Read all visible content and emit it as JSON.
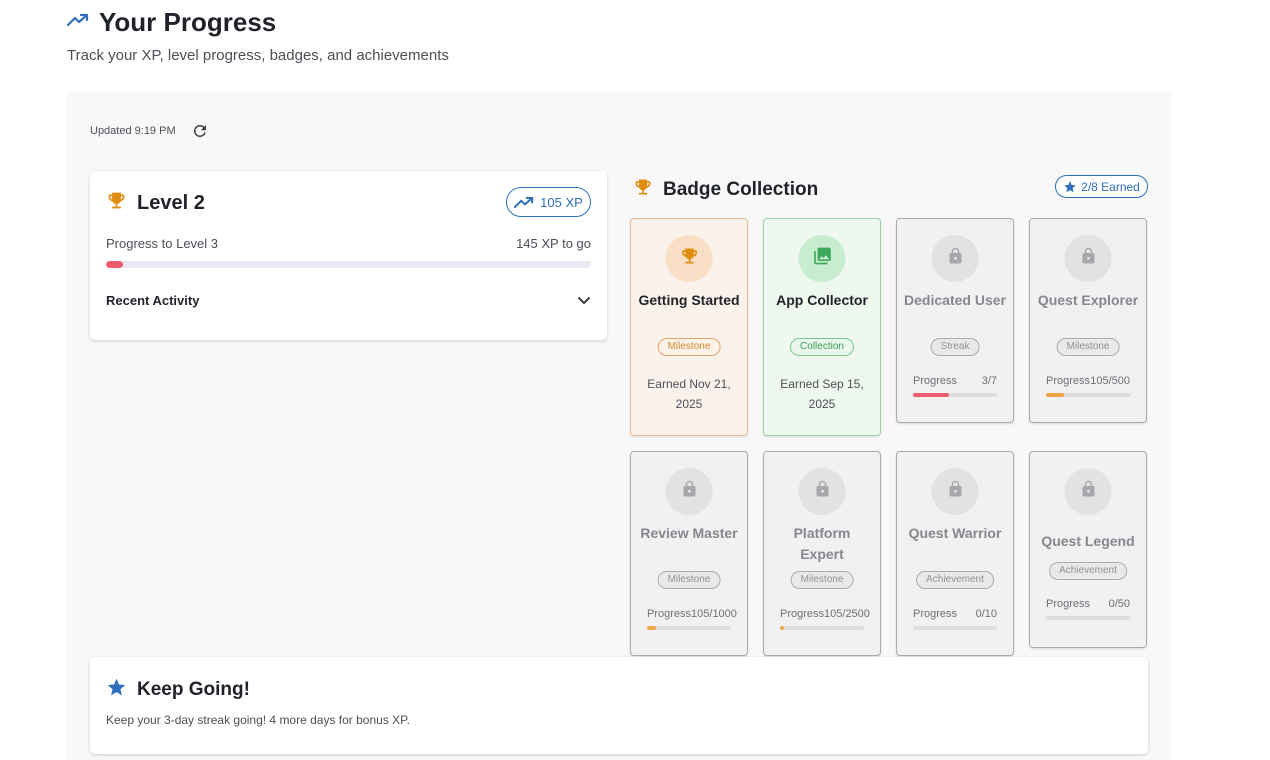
{
  "header": {
    "title": "Your Progress",
    "subtitle": "Track your XP, level progress, badges, and achievements"
  },
  "toolbar": {
    "updated_text": "Updated 9:19 PM"
  },
  "level": {
    "title": "Level 2",
    "xp_chip": "105 XP",
    "progress_label": "Progress to Level 3",
    "xp_to_go": "145 XP to go",
    "progress_fraction": 0.035,
    "recent_activity_label": "Recent Activity"
  },
  "badges": {
    "title": "Badge Collection",
    "earned_chip": "2/8 Earned",
    "items": [
      {
        "name": "Getting Started",
        "category": "Milestone",
        "state": "earned-milestone",
        "icon": "trophy-icon",
        "earned": "Earned Nov 21, 2025"
      },
      {
        "name": "App Collector",
        "category": "Collection",
        "state": "earned-collection",
        "icon": "gallery-icon",
        "earned": "Earned Sep 15, 2025"
      },
      {
        "name": "Dedicated User",
        "category": "Streak",
        "state": "locked",
        "icon": "lock-icon",
        "progress_label": "Progress",
        "progress_value": "3/7",
        "progress_fraction": 0.4286,
        "progress_color": "#ef5c6b"
      },
      {
        "name": "Quest Explorer",
        "category": "Milestone",
        "state": "locked",
        "icon": "lock-icon",
        "progress_label": "Progress",
        "progress_value": "105/500",
        "progress_fraction": 0.21,
        "progress_color": "#eba548"
      },
      {
        "name": "Review Master",
        "category": "Milestone",
        "state": "locked",
        "icon": "lock-icon",
        "progress_label": "Progress",
        "progress_value": "105/1000",
        "progress_fraction": 0.105,
        "progress_color": "#eba548"
      },
      {
        "name": "Platform Expert",
        "category": "Milestone",
        "state": "locked",
        "icon": "lock-icon",
        "progress_label": "Progress",
        "progress_value": "105/2500",
        "progress_fraction": 0.042,
        "progress_color": "#eba548"
      },
      {
        "name": "Quest Warrior",
        "category": "Achievement",
        "state": "locked",
        "icon": "lock-icon",
        "progress_label": "Progress",
        "progress_value": "0/10",
        "progress_fraction": 0,
        "progress_color": "#eba548"
      },
      {
        "name": "Quest Legend",
        "category": "Achievement",
        "state": "locked",
        "icon": "lock-icon",
        "progress_label": "Progress",
        "progress_value": "0/50",
        "progress_fraction": 0,
        "progress_color": "#eba548"
      }
    ]
  },
  "keep_going": {
    "title": "Keep Going!",
    "text": "Keep your 3-day streak going! 4 more days for bonus XP."
  },
  "colors": {
    "accent_blue": "#2f6fbd",
    "trophy_gold": "#e08d12",
    "progress_red": "#ef5c6b",
    "progress_orange": "#eba548"
  }
}
